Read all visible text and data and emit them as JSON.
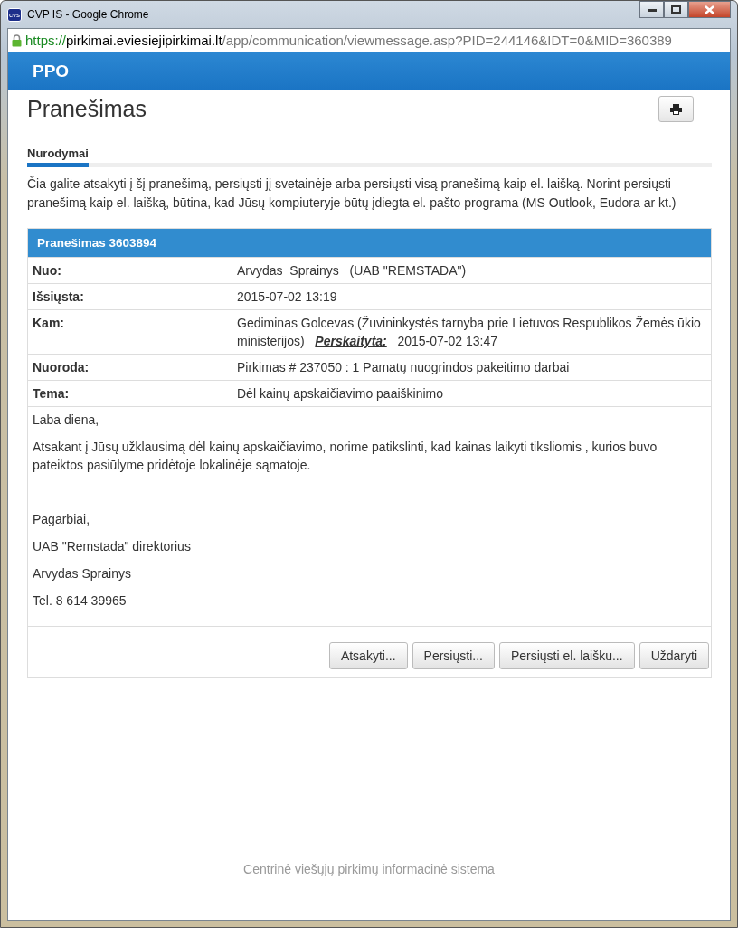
{
  "window": {
    "title": "CVP IS - Google Chrome",
    "app_badge": "cvs"
  },
  "address_bar": {
    "scheme": "https://",
    "host": "pirkimai.eviesiejipirkimai.lt",
    "path": "/app/communication/viewmessage.asp?PID=244146&IDT=0&MID=360389"
  },
  "brand": "PPO",
  "page_title": "Pranešimas",
  "section_tab": "Nurodymai",
  "instructions": "Čia galite atsakyti į šį pranešimą, persiųsti jį svetainėje arba persiųsti visą pranešimą kaip el. laišką. Norint persiųsti pranešimą kaip el. laišką, būtina, kad Jūsų kompiuteryje būtų įdiegta el. pašto programa (MS Outlook, Eudora ar kt.)",
  "message": {
    "header": "Pranešimas 3603894",
    "fields": [
      {
        "label": "Nuo:",
        "value": "Arvydas  Sprainys   (UAB \"REMSTADA\")"
      },
      {
        "label": "Išsiųsta:",
        "value": "2015-07-02 13:19"
      },
      {
        "label": "Kam:",
        "value": "Gediminas Golcevas (Žuvininkystės tarnyba prie Lietuvos Respublikos Žemės ūkio ministerijos)   **Perskaityta:**   2015-07-02 13:47"
      },
      {
        "label": "Nuoroda:",
        "value": "Pirkimas # 237050 : 1 Pamatų nuogrindos pakeitimo darbai"
      },
      {
        "label": "Tema:",
        "value": "Dėl kainų apskaičiavimo paaiškinimo"
      }
    ],
    "body": [
      "Laba diena,",
      "Atsakant į Jūsų užklausimą dėl kainų apskaičiavimo, norime patikslinti, kad kainas laikyti tiksliomis , kurios buvo pateiktos pasiūlyme pridėtoje lokalinėje sąmatoje."
    ],
    "signature": [
      "Pagarbiai,",
      "UAB \"Remstada\" direktorius",
      "Arvydas Sprainys",
      "Tel. 8 614 39965"
    ],
    "buttons": [
      "Atsakyti...",
      "Persiųsti...",
      "Persiųsti el. laišku...",
      "Uždaryti"
    ]
  },
  "footer": "Centrinė viešųjų pirkimų informacinė sistema"
}
